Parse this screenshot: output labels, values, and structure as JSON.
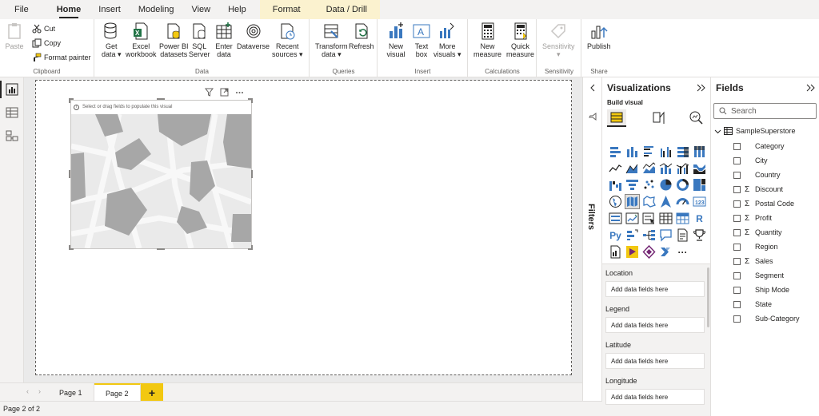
{
  "menu": {
    "tabs": [
      "File",
      "Home",
      "Insert",
      "Modeling",
      "View",
      "Help"
    ],
    "context_tabs": [
      "Format",
      "Data / Drill"
    ],
    "active": "Home"
  },
  "ribbon": {
    "clipboard": {
      "paste": "Paste",
      "cut": "Cut",
      "copy": "Copy",
      "format_painter": "Format painter",
      "label": "Clipboard"
    },
    "data": {
      "get_data": [
        "Get",
        "data ▾"
      ],
      "excel": [
        "Excel",
        "workbook"
      ],
      "powerbi": [
        "Power BI",
        "datasets"
      ],
      "sql": [
        "SQL",
        "Server"
      ],
      "enter": [
        "Enter",
        "data"
      ],
      "dataverse": [
        "Dataverse",
        ""
      ],
      "recent": [
        "Recent",
        "sources ▾"
      ],
      "label": "Data"
    },
    "queries": {
      "transform": [
        "Transform",
        "data ▾"
      ],
      "refresh": [
        "Refresh",
        ""
      ],
      "label": "Queries"
    },
    "insert": {
      "new_visual": [
        "New",
        "visual"
      ],
      "text_box": [
        "Text",
        "box"
      ],
      "more_visuals": [
        "More",
        "visuals ▾"
      ],
      "label": "Insert"
    },
    "calculations": {
      "new_measure": [
        "New",
        "measure"
      ],
      "quick_measure": [
        "Quick",
        "measure"
      ],
      "label": "Calculations"
    },
    "sensitivity": {
      "btn": [
        "Sensitivity",
        "▾"
      ],
      "label": "Sensitivity"
    },
    "share": {
      "publish": [
        "Publish",
        ""
      ],
      "label": "Share"
    }
  },
  "visual": {
    "placeholder_msg": "Select or drag fields to populate this visual"
  },
  "filters": {
    "label": "Filters"
  },
  "visualizations": {
    "title": "Visualizations",
    "build_visual": "Build visual",
    "wells": [
      {
        "label": "Location",
        "placeholder": "Add data fields here"
      },
      {
        "label": "Legend",
        "placeholder": "Add data fields here"
      },
      {
        "label": "Latitude",
        "placeholder": "Add data fields here"
      },
      {
        "label": "Longitude",
        "placeholder": "Add data fields here"
      }
    ]
  },
  "fields": {
    "title": "Fields",
    "search_placeholder": "Search",
    "table": "SampleSuperstore",
    "items": [
      {
        "name": "Category",
        "sigma": false
      },
      {
        "name": "City",
        "sigma": false
      },
      {
        "name": "Country",
        "sigma": false
      },
      {
        "name": "Discount",
        "sigma": true
      },
      {
        "name": "Postal Code",
        "sigma": true
      },
      {
        "name": "Profit",
        "sigma": true
      },
      {
        "name": "Quantity",
        "sigma": true
      },
      {
        "name": "Region",
        "sigma": false
      },
      {
        "name": "Sales",
        "sigma": true
      },
      {
        "name": "Segment",
        "sigma": false
      },
      {
        "name": "Ship Mode",
        "sigma": false
      },
      {
        "name": "State",
        "sigma": false
      },
      {
        "name": "Sub-Category",
        "sigma": false
      }
    ]
  },
  "pages": {
    "tabs": [
      "Page 1",
      "Page 2"
    ],
    "active": "Page 2",
    "add": "+"
  },
  "status": {
    "text": "Page 2 of 2"
  },
  "colors": {
    "accent_yellow": "#f2c811",
    "context_tab_bg": "#fbf2cf",
    "visual_blue": "#3a78bf"
  }
}
